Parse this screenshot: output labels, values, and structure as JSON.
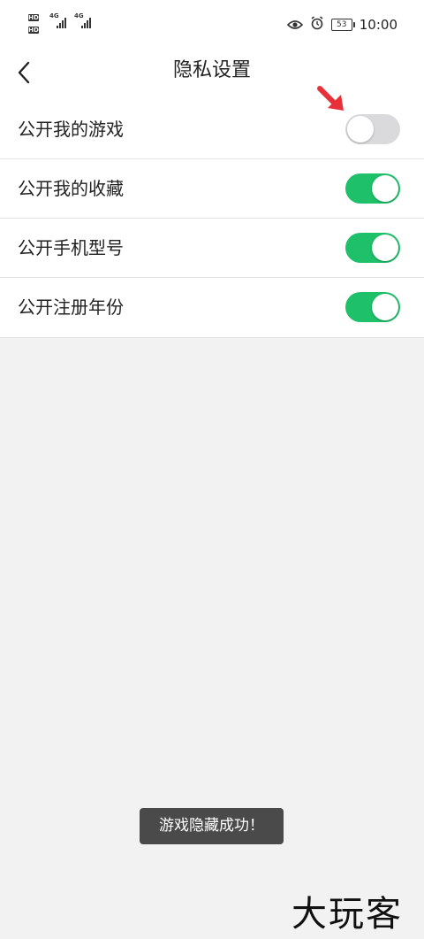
{
  "status_bar": {
    "sim1_network": "4G",
    "sim2_network": "4G",
    "hd_label": "HD",
    "battery_level": "53",
    "time": "10:00",
    "icons": [
      "eye-icon",
      "alarm-icon",
      "battery-icon"
    ]
  },
  "nav": {
    "title": "隐私设置",
    "back_icon": "chevron-left-icon"
  },
  "settings": [
    {
      "label": "公开我的游戏",
      "enabled": false
    },
    {
      "label": "公开我的收藏",
      "enabled": true
    },
    {
      "label": "公开手机型号",
      "enabled": true
    },
    {
      "label": "公开注册年份",
      "enabled": true
    }
  ],
  "annotation": {
    "icon": "red-arrow-icon",
    "color": "#e8303a"
  },
  "toast": {
    "message": "游戏隐藏成功！"
  },
  "watermark": {
    "text": "大玩客"
  },
  "colors": {
    "toggle_on": "#1ec06a",
    "toggle_off": "#dadadd",
    "background": "#f2f2f2"
  }
}
